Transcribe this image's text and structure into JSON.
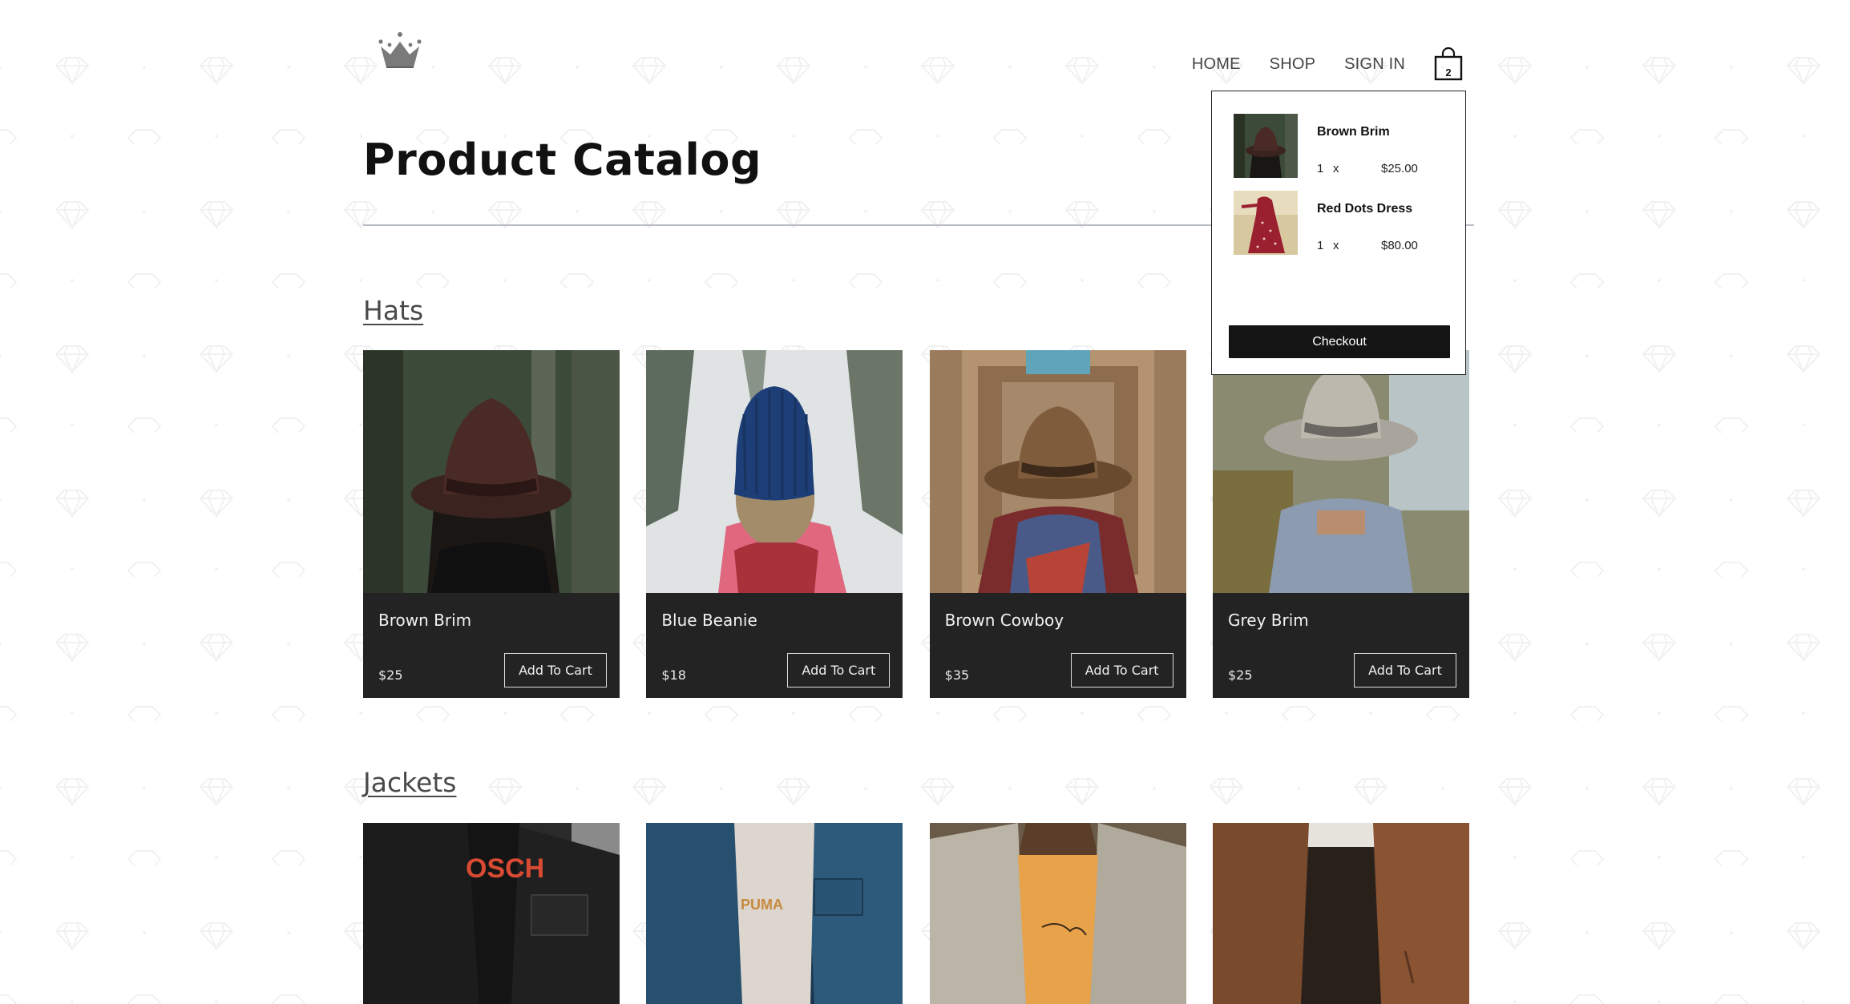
{
  "header": {
    "logo_icon": "crown-icon",
    "nav": {
      "home": "HOME",
      "shop": "SHOP",
      "sign_in": "SIGN IN"
    },
    "cart": {
      "icon": "shopping-bag-icon",
      "count": "2"
    }
  },
  "page_title": "Product Catalog",
  "sections": [
    {
      "title": "Hats",
      "items": [
        {
          "name": "Brown Brim",
          "price": "$25",
          "button": "Add To Cart"
        },
        {
          "name": "Blue Beanie",
          "price": "$18",
          "button": "Add To Cart"
        },
        {
          "name": "Brown Cowboy",
          "price": "$35",
          "button": "Add To Cart"
        },
        {
          "name": "Grey Brim",
          "price": "$25",
          "button": "Add To Cart"
        }
      ]
    },
    {
      "title": "Jackets",
      "items": [
        {
          "image": "black-denim-jacket"
        },
        {
          "image": "blue-denim-jacket"
        },
        {
          "image": "light-denim-jacket"
        },
        {
          "image": "brown-suede-jacket"
        }
      ]
    }
  ],
  "cart_dropdown": {
    "items": [
      {
        "name": "Brown Brim",
        "quantity": "1",
        "times": "x",
        "price": "$25.00"
      },
      {
        "name": "Red Dots Dress",
        "quantity": "1",
        "times": "x",
        "price": "$80.00"
      }
    ],
    "checkout_label": "Checkout"
  },
  "colors": {
    "card_background": "#232323",
    "checkout_button": "#141414",
    "divider": "#b8bcc4"
  }
}
